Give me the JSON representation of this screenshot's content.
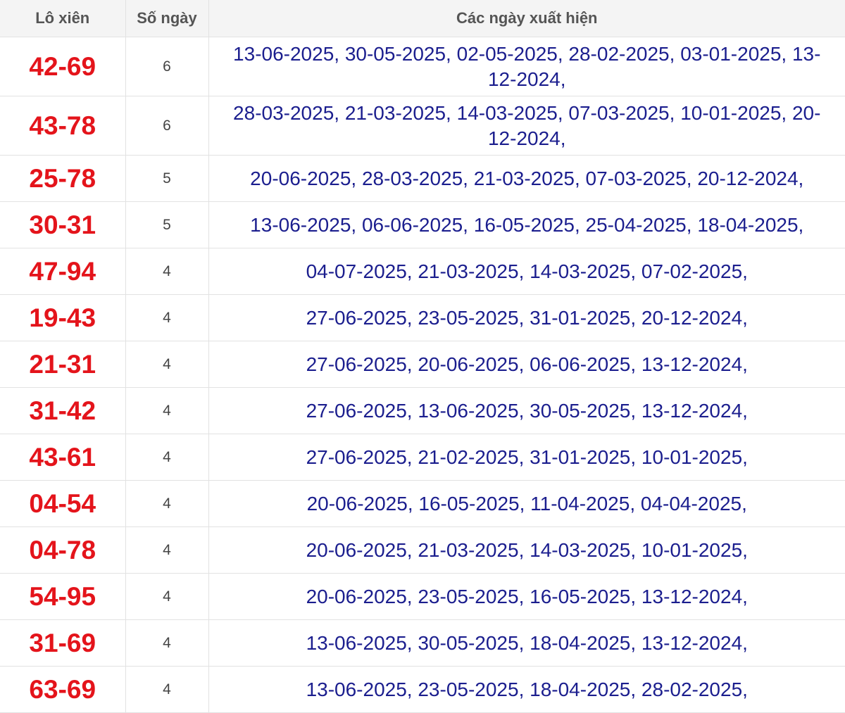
{
  "header": {
    "col_pair": "Lô xiên",
    "col_count": "Số ngày",
    "col_dates": "Các ngày xuất hiện"
  },
  "colors": {
    "pair_text": "#e4141b",
    "dates_text": "#1b1e8e",
    "header_background": "#f4f4f4",
    "grid_border": "#e2e2e2"
  },
  "rows": [
    {
      "pair": "42-69",
      "count": "6",
      "dates": "13-06-2025, 30-05-2025, 02-05-2025, 28-02-2025, 03-01-2025, 13-12-2024,"
    },
    {
      "pair": "43-78",
      "count": "6",
      "dates": "28-03-2025, 21-03-2025, 14-03-2025, 07-03-2025, 10-01-2025, 20-12-2024,"
    },
    {
      "pair": "25-78",
      "count": "5",
      "dates": "20-06-2025, 28-03-2025, 21-03-2025, 07-03-2025, 20-12-2024,"
    },
    {
      "pair": "30-31",
      "count": "5",
      "dates": "13-06-2025, 06-06-2025, 16-05-2025, 25-04-2025, 18-04-2025,"
    },
    {
      "pair": "47-94",
      "count": "4",
      "dates": "04-07-2025, 21-03-2025, 14-03-2025, 07-02-2025,"
    },
    {
      "pair": "19-43",
      "count": "4",
      "dates": "27-06-2025, 23-05-2025, 31-01-2025, 20-12-2024,"
    },
    {
      "pair": "21-31",
      "count": "4",
      "dates": "27-06-2025, 20-06-2025, 06-06-2025, 13-12-2024,"
    },
    {
      "pair": "31-42",
      "count": "4",
      "dates": "27-06-2025, 13-06-2025, 30-05-2025, 13-12-2024,"
    },
    {
      "pair": "43-61",
      "count": "4",
      "dates": "27-06-2025, 21-02-2025, 31-01-2025, 10-01-2025,"
    },
    {
      "pair": "04-54",
      "count": "4",
      "dates": "20-06-2025, 16-05-2025, 11-04-2025, 04-04-2025,"
    },
    {
      "pair": "04-78",
      "count": "4",
      "dates": "20-06-2025, 21-03-2025, 14-03-2025, 10-01-2025,"
    },
    {
      "pair": "54-95",
      "count": "4",
      "dates": "20-06-2025, 23-05-2025, 16-05-2025, 13-12-2024,"
    },
    {
      "pair": "31-69",
      "count": "4",
      "dates": "13-06-2025, 30-05-2025, 18-04-2025, 13-12-2024,"
    },
    {
      "pair": "63-69",
      "count": "4",
      "dates": "13-06-2025, 23-05-2025, 18-04-2025, 28-02-2025,"
    }
  ]
}
